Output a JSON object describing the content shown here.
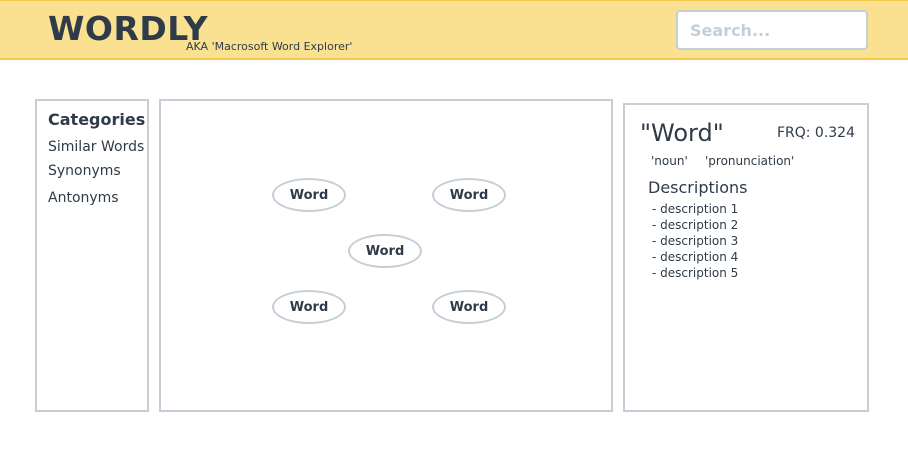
{
  "header": {
    "logo": "WORDLY",
    "tagline": "AKA 'Macrosoft Word Explorer'",
    "search_placeholder": "Search..."
  },
  "categories": {
    "title": "Categories",
    "items": [
      "Similar Words",
      "Synonyms",
      "Antonyms"
    ]
  },
  "graph": {
    "nodes": [
      "Word",
      "Word",
      "Word",
      "Word",
      "Word"
    ]
  },
  "details": {
    "word": "\"Word\"",
    "frequency": "FRQ: 0.324",
    "part_of_speech": "'noun'",
    "pronunciation": "'pronunciation'",
    "descriptions_title": "Descriptions",
    "descriptions": [
      "- description 1",
      "- description 2",
      "- description 3",
      "- description 4",
      "- description 5"
    ]
  },
  "colors": {
    "header_bg": "#fae191",
    "header_border": "#f2c94c",
    "panel_border": "#c7ced6",
    "text": "#2f3b48"
  }
}
